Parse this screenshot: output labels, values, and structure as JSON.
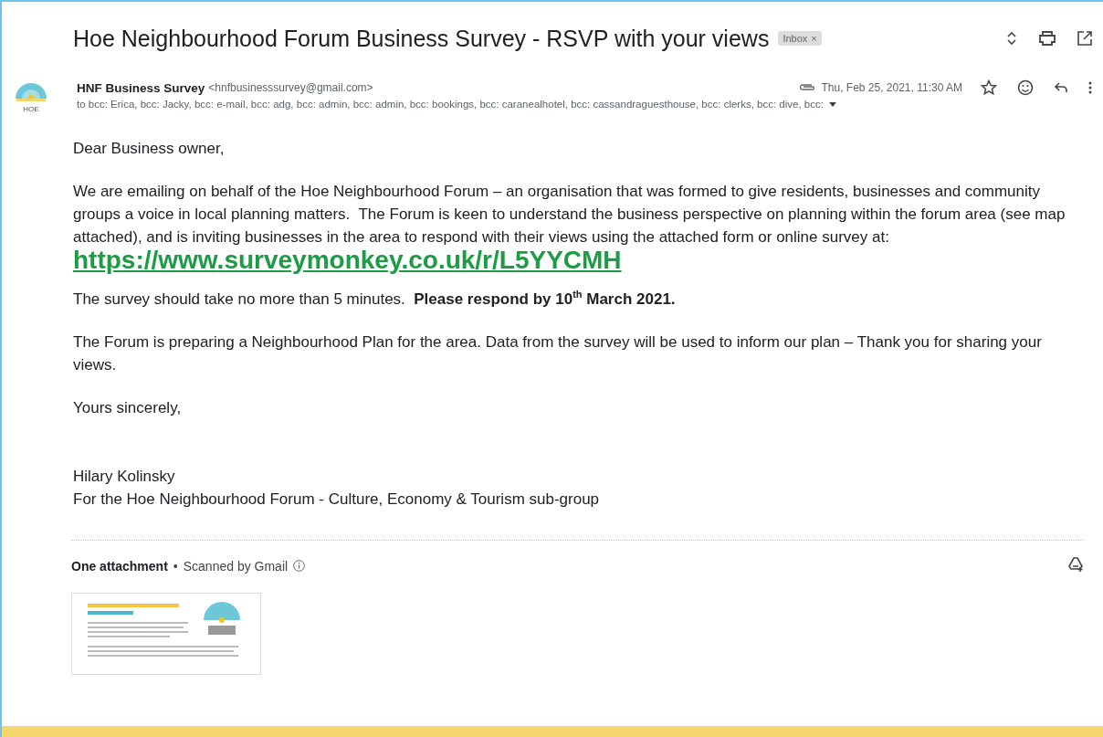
{
  "subject": "Hoe Neighbourhood Forum Business Survey - RSVP with your views",
  "label": {
    "text": "Inbox",
    "close": "×"
  },
  "sender": {
    "avatar_text": "HOE",
    "name": "HNF Business Survey",
    "email": "<hnfbusinesssurvey@gmail.com>",
    "date": "Thu, Feb 25, 2021, 11:30 AM",
    "starred": false
  },
  "recipients": "to bcc: Erica, bcc: Jacky, bcc: e-mail, bcc: adg, bcc: admin, bcc: admin, bcc: bookings, bcc: caranealhotel, bcc: cassandraguesthouse, bcc: clerks, bcc: dive, bcc:",
  "body": [
    {
      "kind": "text",
      "text": "Dear Business owner,"
    },
    {
      "kind": "text",
      "text": "We are emailing on behalf of the Hoe Neighbourhood Forum – an organisation that was formed to give residents, businesses and community groups a voice in local planning matters.  The Forum is keen to understand the business perspective on planning within the forum area (see map attached), and is inviting businesses in the area to respond with their views using the attached form or online survey at: ",
      "link": "https://www.surveymonkey.co.uk/r/L5YYCMH"
    },
    {
      "kind": "text",
      "text": "The survey should take no more than 5 minutes.  **Please respond by 10$^{th}$ March 2021.**"
    },
    {
      "kind": "text",
      "text": "The Forum is preparing a Neighbourhood Plan for the area. Data from the survey will be used to inform our plan – Thank you for sharing your views."
    },
    {
      "kind": "text",
      "text": "Yours sincerely,"
    },
    {
      "kind": "lines",
      "lines": [
        "Hilary Kolinsky",
        "For the Hoe Neighbourhood Forum - Culture, Economy & Tourism sub-group"
      ]
    }
  ],
  "attachments": {
    "title": "One attachment",
    "separator": "•",
    "scan_note": "Scanned by Gmail"
  }
}
